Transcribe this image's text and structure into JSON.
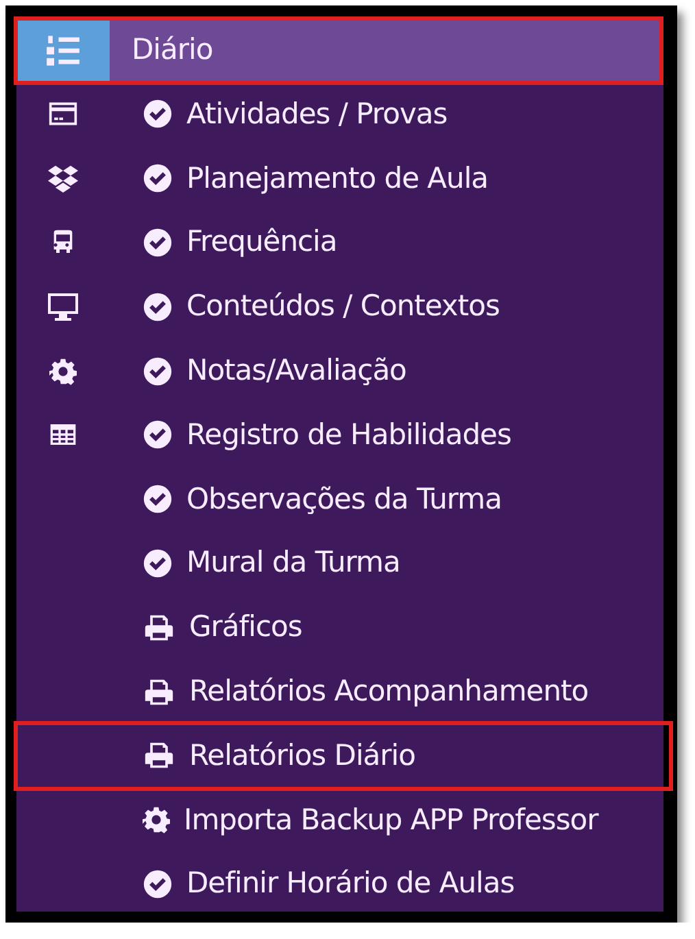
{
  "header": {
    "title": "Diário",
    "selected": true,
    "highlighted": true
  },
  "rail": [
    {
      "kind": "card"
    },
    {
      "kind": "dropbox"
    },
    {
      "kind": "bus"
    },
    {
      "kind": "desktop"
    },
    {
      "kind": "gear"
    },
    {
      "kind": "table"
    }
  ],
  "items": [
    {
      "label": "Atividades / Provas",
      "kind": "check",
      "highlighted": false
    },
    {
      "label": "Planejamento de Aula",
      "kind": "check",
      "highlighted": false
    },
    {
      "label": "Frequência",
      "kind": "check",
      "highlighted": false
    },
    {
      "label": "Conteúdos / Contextos",
      "kind": "check",
      "highlighted": false
    },
    {
      "label": "Notas/Avaliação",
      "kind": "check",
      "highlighted": false
    },
    {
      "label": "Registro de Habilidades",
      "kind": "check",
      "highlighted": false
    },
    {
      "label": "Observações da Turma",
      "kind": "check",
      "highlighted": false
    },
    {
      "label": "Mural da Turma",
      "kind": "check",
      "highlighted": false
    },
    {
      "label": "Gráficos",
      "kind": "print",
      "highlighted": false
    },
    {
      "label": "Relatórios Acompanhamento",
      "kind": "print",
      "highlighted": false
    },
    {
      "label": "Relatórios Diário",
      "kind": "print",
      "highlighted": true
    },
    {
      "label": "Importa Backup APP Professor",
      "kind": "gear",
      "highlighted": false
    },
    {
      "label": "Definir Horário de Aulas",
      "kind": "check",
      "highlighted": false
    }
  ]
}
